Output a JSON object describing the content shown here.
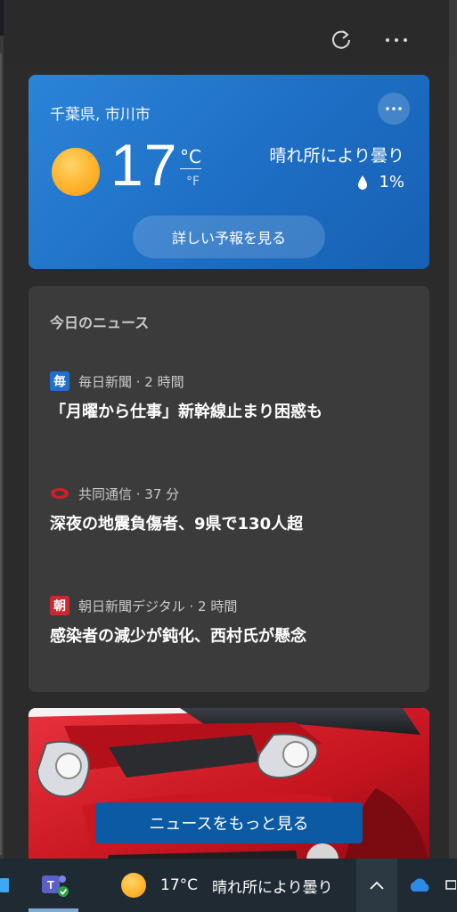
{
  "weather": {
    "location": "千葉県, 市川市",
    "temperature": "17",
    "unit_c": "°C",
    "unit_f": "°F",
    "condition": "晴れ所により曇り",
    "precipitation": "1%",
    "forecast_button": "詳しい予報を見る",
    "icon": "sun-icon"
  },
  "news": {
    "title": "今日のニュース",
    "stories": [
      {
        "source": "毎日新聞 · 2 時間",
        "logo_text": "毎",
        "logo_color": "#1e6fd0",
        "headline": "「月曜から仕事」新幹線止まり困惑も"
      },
      {
        "source": "共同通信 · 37 分",
        "logo_text": "",
        "logo_color": "#cc1f2a",
        "headline": "深夜の地震負傷者、9県で130人超"
      },
      {
        "source": "朝日新聞デジタル · 2 時間",
        "logo_text": "朝",
        "logo_color": "#c8282e",
        "headline": "感染者の減少が鈍化、西村氏が懸念"
      }
    ]
  },
  "more_news_button": "ニュースをもっと見る",
  "taskbar": {
    "weather_temp": "17°C",
    "weather_cond": "晴れ所により曇り"
  },
  "colors": {
    "weather_card": "#1d6ec4",
    "news_card": "#3b3b3b",
    "accent_button": "#0b5aa3"
  }
}
